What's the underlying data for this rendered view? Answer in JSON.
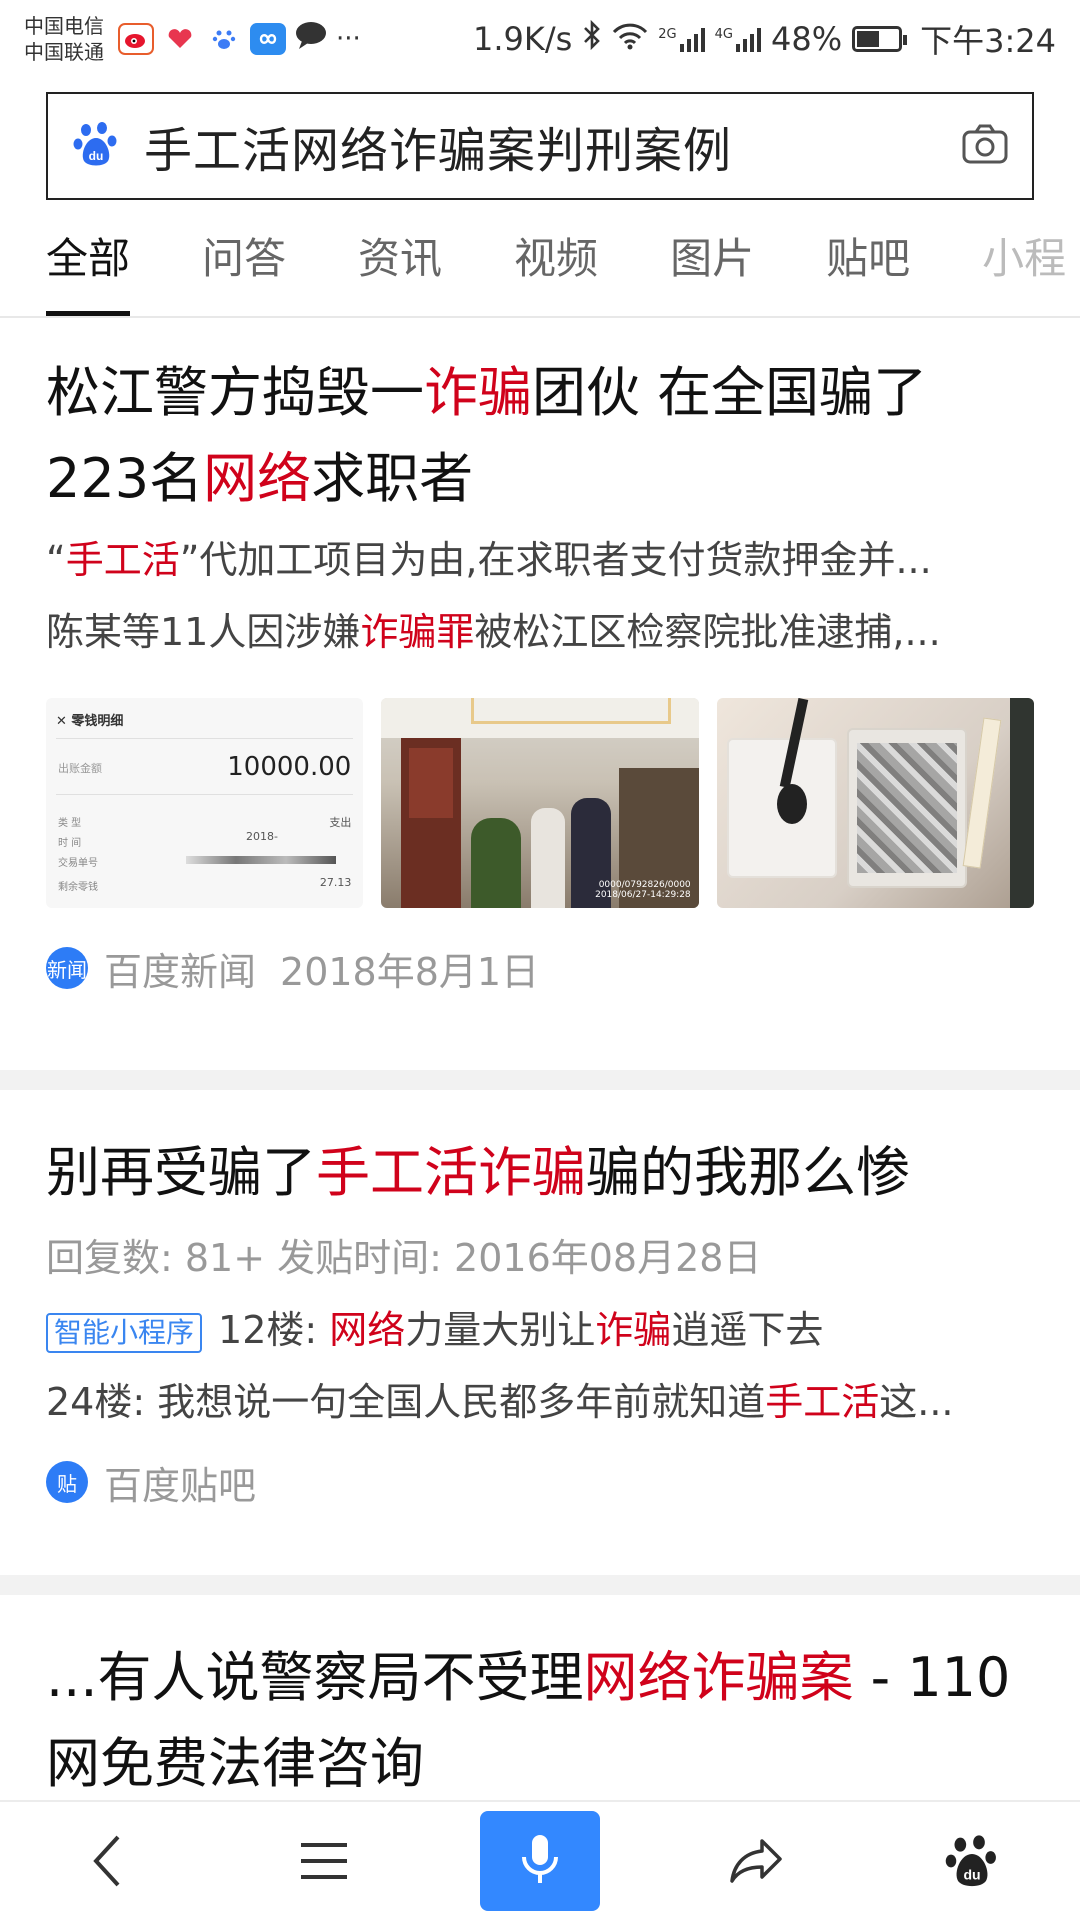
{
  "status_bar": {
    "carrier_1": "中国电信",
    "carrier_2": "中国联通",
    "net_speed": "1.9K/s",
    "net_1": "2G",
    "net_2": "4G",
    "battery": "48%",
    "time": "下午3:24",
    "more": "···"
  },
  "search": {
    "query": "手工活网络诈骗案判刑案例",
    "logo_icon": "baidu-paw-icon",
    "camera_icon": "camera-icon"
  },
  "tabs": [
    {
      "label": "全部",
      "active": true
    },
    {
      "label": "问答"
    },
    {
      "label": "资讯"
    },
    {
      "label": "视频"
    },
    {
      "label": "图片"
    },
    {
      "label": "贴吧"
    },
    {
      "label": "小程"
    }
  ],
  "results": [
    {
      "title_parts": [
        "松江警方捣毁一",
        "诈骗",
        "团伙 在全国骗了",
        "223名",
        "网络",
        "求职者"
      ],
      "line1_parts": [
        "“",
        "手工活",
        "”代加工项目为由,在求职者支付货款押金并..."
      ],
      "line2_parts": [
        "陈某等11人因涉嫌",
        "诈骗罪",
        "被松江区检察院批准逮捕,..."
      ],
      "receipt": {
        "header": "零钱明细",
        "amount_label": "出账金额",
        "amount": "10000.00",
        "type_label": "类  型",
        "type_value": "支出",
        "time_label": "时  间",
        "time_value": "2018-",
        "order_label": "交易单号",
        "balance_label": "剩余零钱",
        "balance_value": "27.13"
      },
      "photo_stamp": "0000/0792826/0000\n2018/06/27-14:29:28",
      "source": "百度新闻",
      "date": "2018年8月1日",
      "source_icon": "新闻"
    },
    {
      "title_parts": [
        "别再受骗了",
        "手工活诈骗",
        "骗的我那么惨"
      ],
      "meta": "回复数: 81+  发贴时间: 2016年08月28日",
      "badge": "智能小程序",
      "line1_parts": [
        "12楼: ",
        "网络",
        "力量大别让",
        "诈骗",
        "逍遥下去"
      ],
      "line2_parts": [
        "24楼: 我想说一句全国人民都多年前就知道",
        "手工活",
        "这..."
      ],
      "source": "百度贴吧",
      "source_icon": "贴"
    },
    {
      "title_parts": [
        "...有人说警察局不受理",
        "网络诈骗案",
        " - 110"
      ],
      "title_line2": "网免费法律咨询"
    }
  ],
  "bottom_nav": {
    "back_icon": "back-arrow-icon",
    "menu_icon": "menu-icon",
    "mic_icon": "microphone-icon",
    "share_icon": "share-icon",
    "home_icon": "baidu-paw-icon"
  },
  "colors": {
    "highlight": "#d0021b",
    "accent": "#3388ff"
  }
}
